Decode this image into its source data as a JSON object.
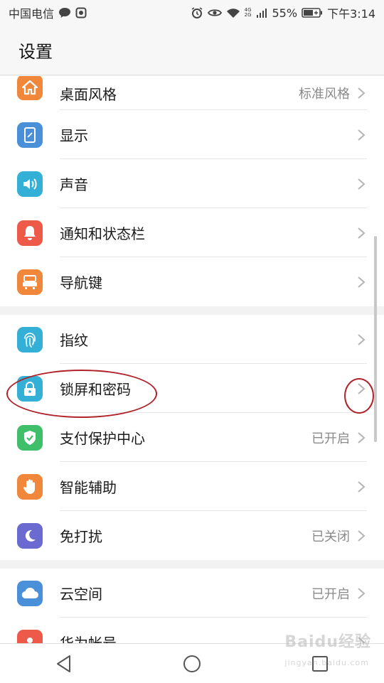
{
  "status_bar": {
    "carrier": "中国电信",
    "battery": "55%",
    "net_label_top": "4G",
    "net_label_bottom": "2G",
    "time": "下午3:14"
  },
  "header": {
    "title": "设置"
  },
  "groups": [
    {
      "items": [
        {
          "label": "桌面风格",
          "value": "标准风格",
          "icon": "home-icon",
          "color": "#f0873a"
        },
        {
          "label": "显示",
          "value": "",
          "icon": "display-icon",
          "color": "#4a90d9"
        },
        {
          "label": "声音",
          "value": "",
          "icon": "speaker-icon",
          "color": "#34b0d6"
        },
        {
          "label": "通知和状态栏",
          "value": "",
          "icon": "bell-icon",
          "color": "#ee5a4a"
        },
        {
          "label": "导航键",
          "value": "",
          "icon": "navigation-key-icon",
          "color": "#f0873a"
        }
      ]
    },
    {
      "items": [
        {
          "label": "指纹",
          "value": "",
          "icon": "fingerprint-icon",
          "color": "#34b0d6"
        },
        {
          "label": "锁屏和密码",
          "value": "",
          "icon": "lock-icon",
          "color": "#34b0d6"
        },
        {
          "label": "支付保护中心",
          "value": "已开启",
          "icon": "shield-check-icon",
          "color": "#3fbf6a"
        },
        {
          "label": "智能辅助",
          "value": "",
          "icon": "hand-icon",
          "color": "#f0873a"
        },
        {
          "label": "免打扰",
          "value": "已关闭",
          "icon": "moon-icon",
          "color": "#6a6ad0"
        }
      ]
    },
    {
      "items": [
        {
          "label": "云空间",
          "value": "已开启",
          "icon": "cloud-icon",
          "color": "#4a90d9"
        },
        {
          "label": "华为帐号",
          "value": "",
          "icon": "account-icon",
          "color": "#ee5a4a"
        }
      ]
    }
  ],
  "watermark": "Baidu经验",
  "watermark_sub": "jingyan.baidu.com"
}
